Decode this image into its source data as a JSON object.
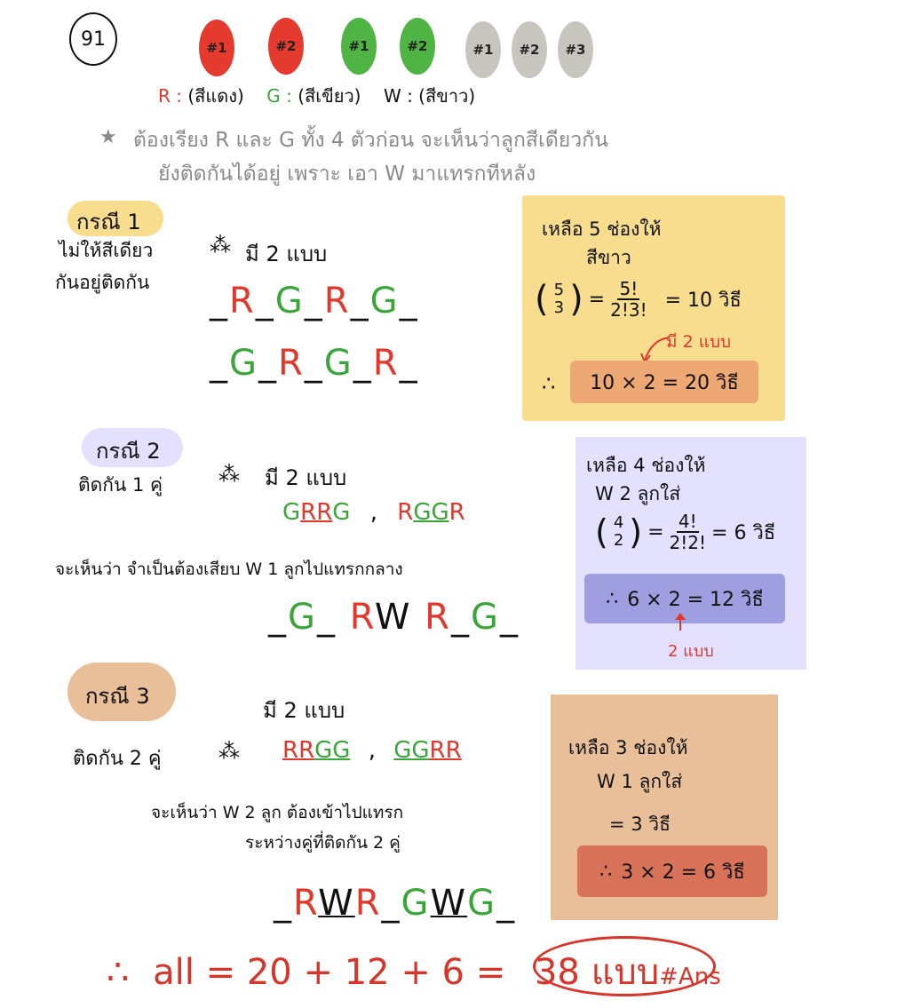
{
  "problem_number": "91",
  "balls": [
    {
      "label": "#1",
      "color": "#e53a2e"
    },
    {
      "label": "#2",
      "color": "#e53a2e"
    },
    {
      "label": "#1",
      "color": "#4fb443"
    },
    {
      "label": "#2",
      "color": "#4fb443"
    },
    {
      "label": "#1",
      "color": "#c8c5bf"
    },
    {
      "label": "#2",
      "color": "#c8c5bf"
    },
    {
      "label": "#3",
      "color": "#c8c5bf"
    }
  ],
  "legend": {
    "r_key": "R :",
    "r_text": "(สีแดง)",
    "g_key": "G :",
    "g_text": "(สีเขียว)",
    "w_key": "W :",
    "w_text": "(สีขาว)"
  },
  "note_line1": "ต้องเรียง R และ G ทั้ง 4 ตัวก่อน จะเห็นว่าลูกสีเดียวกัน",
  "note_line2": "ยังติดกันได้อยู่ เพราะ เอา W มาแทรกทีหลัง",
  "case1": {
    "label": "กรณี 1",
    "desc1": "ไม่ให้สีเดียว",
    "desc2": "กันอยู่ติดกัน",
    "count": "มี 2 แบบ",
    "arr1": [
      "R",
      "G",
      "R",
      "G"
    ],
    "arr2": [
      "G",
      "R",
      "G",
      "R"
    ],
    "box_line1": "เหลือ 5 ช่องให้",
    "box_line2": "สีขาว",
    "binom_top": "5",
    "binom_bottom": "3",
    "frac_num": "5!",
    "frac_den": "2!3!",
    "result": "= 10 วิธี",
    "arrow_note": "มี 2 แบบ",
    "final": "10 × 2 = 20 วิธี",
    "therefore": "∴"
  },
  "case2": {
    "label": "กรณี 2",
    "desc": "ติดกัน 1 คู่",
    "count": "มี 2 แบบ",
    "pair1_a": "G",
    "pair1_b": "RR",
    "pair1_c": "G",
    "pair2_a": "R",
    "pair2_b": "GG",
    "pair2_c": "R",
    "explain": "จะเห็นว่า จำเป็นต้องเสียบ W 1 ลูกไปแทรกกลาง",
    "box_line1": "เหลือ 4 ช่องให้",
    "box_line2": "W 2 ลูกใส่",
    "binom_top": "4",
    "binom_bottom": "2",
    "frac_num": "4!",
    "frac_den": "2!2!",
    "result": "= 6 วิธี",
    "final": "6 × 2 = 12 วิธี",
    "arrow_note": "2 แบบ",
    "therefore": "∴"
  },
  "case3": {
    "label": "กรณี 3",
    "count": "มี 2 แบบ",
    "desc": "ติดกัน 2 คู่",
    "pair1_a": "RR",
    "pair1_b": "GG",
    "pair2_a": "GG",
    "pair2_b": "RR",
    "explain1": "จะเห็นว่า W 2 ลูก ต้องเข้าไปแทรก",
    "explain2": "ระหว่างคู่ที่ติดกัน 2 คู่",
    "box_line1": "เหลือ 3 ช่องให้",
    "box_line2": "W 1 ลูกใส่",
    "result": "= 3 วิธี",
    "final": "3 × 2 = 6 วิธี",
    "therefore": "∴"
  },
  "final": {
    "therefore": "∴",
    "text": "all = 20 + 12 + 6 =",
    "answer": "38 แบบ",
    "ans_tag": "#Ans"
  },
  "colors": {
    "red": "#e0392b",
    "green": "#3aa63a",
    "case1_box": "#f8dd8e",
    "case1_inner": "#eda873",
    "case2_box": "#e4e0ff",
    "case2_inner": "#9f9ee0",
    "case3_box": "#e9bf99",
    "case3_inner": "#d8735a"
  }
}
